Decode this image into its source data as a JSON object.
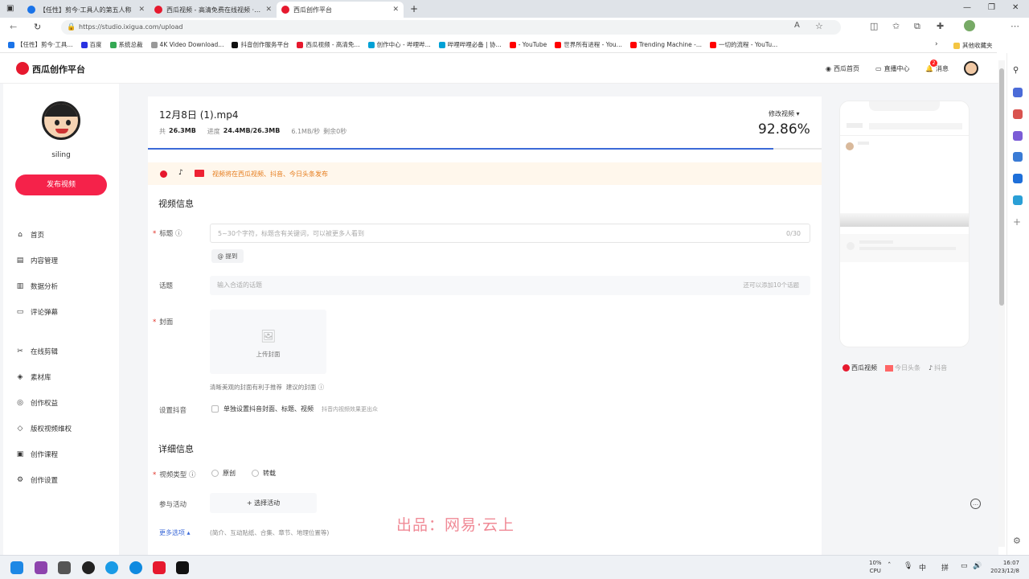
{
  "browser": {
    "tabs": [
      {
        "label": "【任性】剪今·工具人的第五人称",
        "color": "#1a73e8"
      },
      {
        "label": "西瓜视频 - 高清免费在线视频 · 分",
        "color": "#e6192e"
      },
      {
        "label": "西瓜创作平台",
        "color": "#e6192e"
      }
    ],
    "url": "https://studio.ixigua.com/upload",
    "bookmarks": [
      {
        "label": "【任性】剪今·工具...",
        "color": "#1a73e8"
      },
      {
        "label": "百度",
        "color": "#2932e1"
      },
      {
        "label": "系统总裁",
        "color": "#34a853"
      },
      {
        "label": "4K Video Download...",
        "color": "#999999"
      },
      {
        "label": "抖音创作服务平台",
        "color": "#111111"
      },
      {
        "label": "西瓜视频 - 高清免...",
        "color": "#e6192e"
      },
      {
        "label": "创作中心 - 哔哩哔...",
        "color": "#00a1d6"
      },
      {
        "label": "哔哩哔哩必备 | 协...",
        "color": "#00a1d6"
      },
      {
        "label": "- YouTube",
        "color": "#ff0000"
      },
      {
        "label": "世界所有进程 - You...",
        "color": "#ff0000"
      },
      {
        "label": "Trending Machine -...",
        "color": "#ff0000"
      },
      {
        "label": "一切的流程 - YouTu...",
        "color": "#ff0000"
      }
    ],
    "other_bookmarks": "其他收藏夹"
  },
  "header": {
    "logo_text": "西瓜创作平台",
    "nav": {
      "home": "西瓜首页",
      "live": "直播中心",
      "msg": "消息"
    },
    "msg_badge": "2"
  },
  "sidebar": {
    "username": "siling",
    "publish": "发布视频",
    "items": [
      {
        "label": "首页",
        "icon": "⌂"
      },
      {
        "label": "内容管理",
        "icon": "▤"
      },
      {
        "label": "数据分析",
        "icon": "▥"
      },
      {
        "label": "评论弹幕",
        "icon": "▭"
      },
      {
        "label": "在线剪辑",
        "icon": "✂"
      },
      {
        "label": "素材库",
        "icon": "◈"
      },
      {
        "label": "创作权益",
        "icon": "◎"
      },
      {
        "label": "版权视频维权",
        "icon": "◇"
      },
      {
        "label": "创作课程",
        "icon": "▣"
      },
      {
        "label": "创作设置",
        "icon": "⚙"
      }
    ]
  },
  "upload": {
    "filename": "12月8日 (1).mp4",
    "total_label": "共",
    "total": "26.3MB",
    "progress_label": "进度",
    "progress_text": "24.4MB/26.3MB",
    "speed": "6.1MB/秒",
    "remaining": "剩余0秒",
    "change": "修改视频",
    "percent": "92.86%",
    "progress": 0.9286
  },
  "notice": "视频将在西瓜视频、抖音、今日头条发布",
  "form": {
    "section1": "视频信息",
    "title_label": "标题",
    "title_placeholder": "5~30个字符，标题含有关键词，可以被更多人看到",
    "title_count": "0/30",
    "mention": "@ 提到",
    "topic_label": "话题",
    "topic_placeholder": "输入合适的话题",
    "topic_hint": "还可以添加10个话题",
    "cover_label": "封面",
    "cover_upload": "上传封面",
    "cover_hint": "清晰美观的封面有利于推荐",
    "cover_suggest": "建议的封面 ⓘ",
    "douyin_label": "设置抖音",
    "douyin_option": "单独设置抖音封面、标题、视频",
    "douyin_hint": "抖音内视频效果更出众",
    "section2": "详细信息",
    "type_label": "视频类型",
    "type_original": "原创",
    "type_repost": "转载",
    "activity_label": "参与活动",
    "activity_button": "+ 选择活动",
    "more_label": "更多选项 ▴",
    "more_hint": "(简介、互动贴纸、合集、章节、地理位置等)"
  },
  "preview": {
    "platforms": [
      "西瓜视频",
      "今日头条",
      "抖音"
    ]
  },
  "watermark": "出品：网易·云上",
  "taskbar": {
    "cpu_pct": "10%",
    "cpu_label": "CPU",
    "ime1": "中",
    "ime2": "拼",
    "time": "16:07",
    "date": "2023/12/8"
  }
}
